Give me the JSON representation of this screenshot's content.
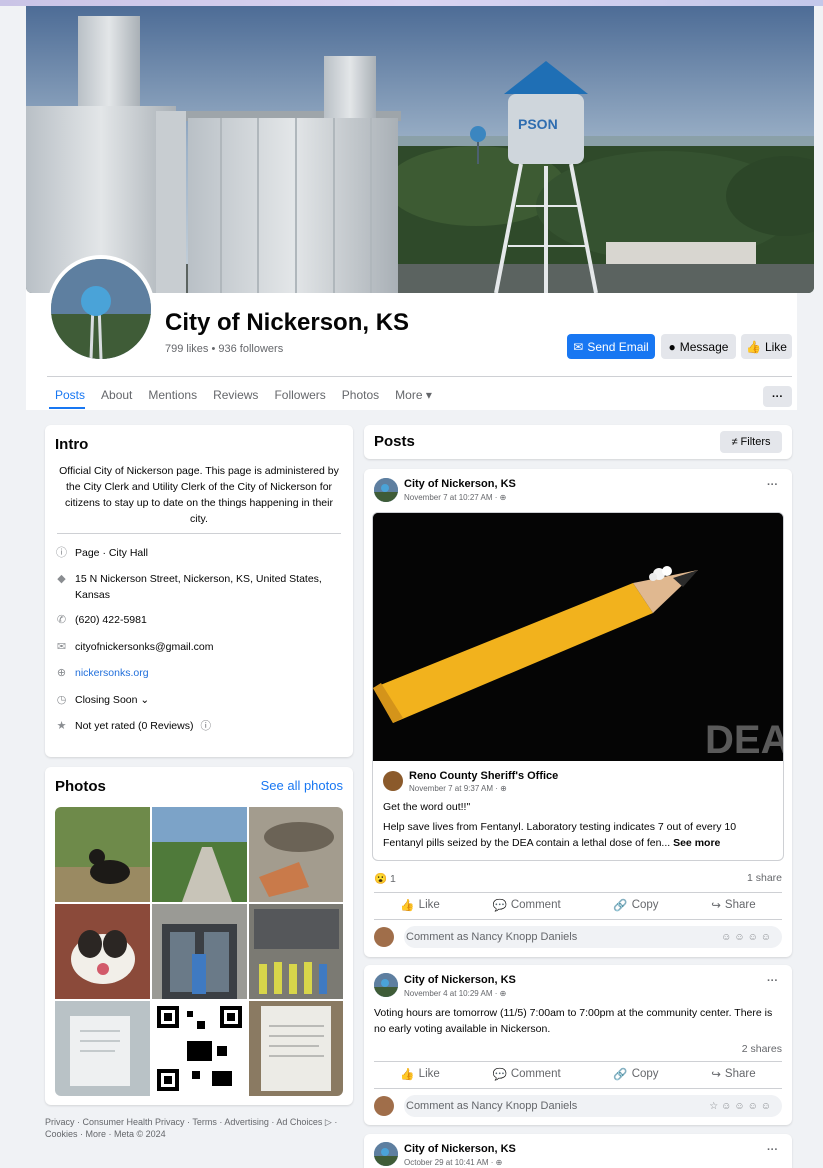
{
  "page": {
    "name": "City of Nickerson, KS",
    "stats": "799 likes • 936 followers"
  },
  "buttons": {
    "send_email": "Send Email",
    "message": "Message",
    "like": "Like",
    "more": "···"
  },
  "tabs": [
    "Posts",
    "About",
    "Mentions",
    "Reviews",
    "Followers",
    "Photos",
    "More ▾"
  ],
  "intro": {
    "title": "Intro",
    "description": "Official City of Nickerson page. This page is administered by the City Clerk and Utility Clerk of the City of Nickerson for citizens to stay up to date on the things happening in their city.",
    "items": [
      {
        "icon": "info-icon",
        "text": "Page · City Hall"
      },
      {
        "icon": "location-icon",
        "text": "15 N Nickerson Street, Nickerson, KS, United States, Kansas"
      },
      {
        "icon": "phone-icon",
        "text": "(620) 422-5981"
      },
      {
        "icon": "email-icon",
        "text": "cityofnickersonks@gmail.com"
      },
      {
        "icon": "globe-icon",
        "text": "nickersonks.org"
      },
      {
        "icon": "clock-icon",
        "text": "Closing Soon ⌄"
      },
      {
        "icon": "star-icon",
        "text": "Not yet rated (0 Reviews)"
      }
    ]
  },
  "photos": {
    "title": "Photos",
    "see_all": "See all photos"
  },
  "footer": "Privacy · Consumer Health Privacy · Terms · Advertising · Ad Choices ▷ · Cookies · More · Meta © 2024",
  "posts_header": {
    "title": "Posts",
    "filters": "Filters"
  },
  "posts": [
    {
      "author": "City of Nickerson, KS",
      "time": "November 7 at 10:27 AM · ⊕",
      "shared": {
        "image_text": "DEA",
        "author": "Reno County Sheriff's Office",
        "time": "November 7 at 9:37 AM · ⊕",
        "line1": "Get the word out!!\"",
        "line2": "Help save lives from Fentanyl. Laboratory testing indicates 7 out of every 10 Fentanyl pills seized by the DEA contain a lethal dose of fen...",
        "see_more": "See more"
      },
      "reactions": "1",
      "shares": "1 share"
    },
    {
      "author": "City of Nickerson, KS",
      "time": "November 4 at 10:29 AM · ⊕",
      "text": "Voting hours are tomorrow (11/5) 7:00am to 7:00pm at the community center. There is no early voting available in Nickerson.",
      "shares": "2 shares"
    },
    {
      "author": "City of Nickerson, KS",
      "time": "October 29 at 10:41 AM · ⊕"
    }
  ],
  "actions": {
    "like": "Like",
    "comment": "Comment",
    "copy": "Copy",
    "share": "Share"
  },
  "comment_placeholder": "Comment as Nancy Knopp Daniels",
  "colors": {
    "accent": "#1877f2",
    "background": "#f0f2f5"
  }
}
